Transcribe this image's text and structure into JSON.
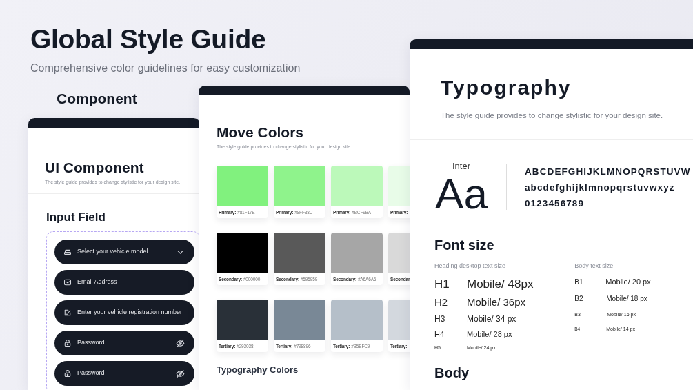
{
  "header": {
    "title": "Global Style Guide",
    "subtitle": "Comprehensive color guidelines for easy customization",
    "section_label": "Component"
  },
  "ui_panel": {
    "title": "UI Component",
    "description": "The style guide provides to change stylistic for your design site.",
    "section": "Input Field",
    "inputs": [
      {
        "kind": "select",
        "placeholder": "Select your vehicle model"
      },
      {
        "kind": "email",
        "placeholder": "Email Address"
      },
      {
        "kind": "registration",
        "placeholder": "Enter your vehicle registration number"
      },
      {
        "kind": "password",
        "placeholder": "Password"
      },
      {
        "kind": "password",
        "placeholder": "Password"
      }
    ]
  },
  "colors_panel": {
    "title": "Move Colors",
    "description": "The style guide provides to change stylistic for your design site.",
    "rows": [
      [
        {
          "name": "Primary:",
          "hex": "#81F17E",
          "color": "#81f17e"
        },
        {
          "name": "Primary:",
          "hex": "#8FF38C",
          "color": "#8ff38c"
        },
        {
          "name": "Primary:",
          "hex": "#BCF9BA",
          "color": "#bcf9ba"
        },
        {
          "name": "Primary:",
          "color": "#e8fce8"
        }
      ],
      [
        {
          "name": "Secondary:",
          "hex": "#000000",
          "color": "#000000"
        },
        {
          "name": "Secondary:",
          "hex": "#595959",
          "color": "#595959"
        },
        {
          "name": "Secondary:",
          "hex": "#A6A6A6",
          "color": "#a6a6a6"
        },
        {
          "name": "Secondar",
          "color": "#d9d9d9"
        }
      ],
      [
        {
          "name": "Tertiary:",
          "hex": "#293038",
          "color": "#293038"
        },
        {
          "name": "Tertiary:",
          "hex": "#798896",
          "color": "#798896"
        },
        {
          "name": "Tertiary:",
          "hex": "#B5BFC9",
          "color": "#b5bfc9"
        },
        {
          "name": "Tertiary:",
          "color": "#d3d8de"
        }
      ]
    ],
    "next_section": "Typography Colors"
  },
  "typography_panel": {
    "title": "Typography",
    "description": "The style guide provides to change stylistic for your design site.",
    "font_name": "Inter",
    "sample": "Aa",
    "glyph_lines": [
      "ABCDEFGHIJKLMNOPQRSTUVW",
      "abcdefghijklmnopqrstuvwxyz",
      "0123456789"
    ],
    "font_size_title": "Font size",
    "heading_label": "Heading desktop text size",
    "headings": [
      {
        "tag": "H1",
        "size": "Mobile/ 48px"
      },
      {
        "tag": "H2",
        "size": "Mobile/ 36px"
      },
      {
        "tag": "H3",
        "size": "Mobile/ 34 px"
      },
      {
        "tag": "H4",
        "size": "Mobile/ 28 px"
      },
      {
        "tag": "H5",
        "size": "Mobile/ 24 px"
      }
    ],
    "body_label": "Body text size",
    "bodies": [
      {
        "tag": "B1",
        "size": "Mobile/ 20 px"
      },
      {
        "tag": "B2",
        "size": "Mobile/ 18 px"
      },
      {
        "tag": "B3",
        "size": "Mobile/ 16 px"
      },
      {
        "tag": "B4",
        "size": "Mobile/ 14 px"
      }
    ],
    "next_section": "Body"
  }
}
